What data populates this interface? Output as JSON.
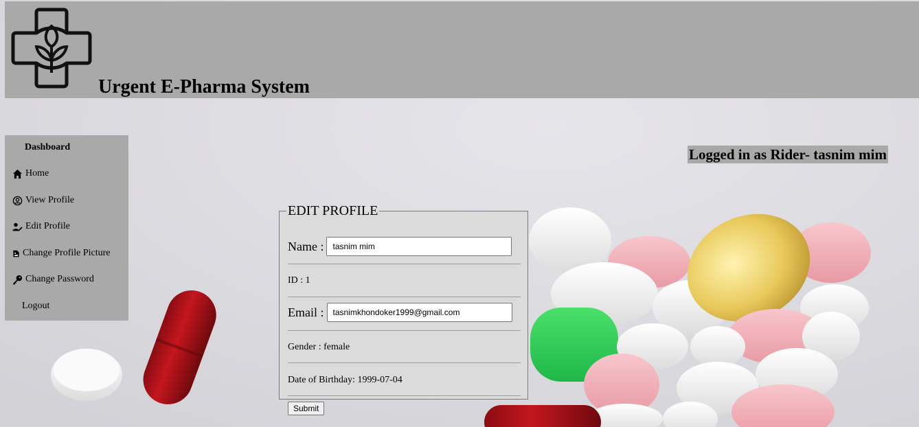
{
  "header": {
    "title": "Urgent E-Pharma System",
    "logo_icon": "pharmacy-cross-leaf-icon"
  },
  "sidebar": {
    "title": "Dashboard",
    "items": [
      {
        "label": "Home",
        "icon": "home-icon"
      },
      {
        "label": "View Profile",
        "icon": "user-circle-icon"
      },
      {
        "label": "Edit Profile",
        "icon": "user-edit-icon"
      },
      {
        "label": "Change Profile Picture",
        "icon": "file-image-icon"
      },
      {
        "label": "Change Password",
        "icon": "key-icon"
      },
      {
        "label": "Logout",
        "icon": ""
      }
    ]
  },
  "status": {
    "logged_in": "Logged in as Rider- tasnim mim"
  },
  "form": {
    "legend": "EDIT PROFILE",
    "name_label": "Name :",
    "name_value": "tasnim mim",
    "id_text": "ID : 1",
    "email_label": "Email :",
    "email_value": "tasnimkhondoker1999@gmail.com",
    "gender_text": "Gender : female",
    "dob_text": "Date of Birthday: 1999-07-04",
    "submit_label": "Submit"
  },
  "colors": {
    "header_bg": "#a9a9a9",
    "sidebar_bg": "#a9a9a9",
    "page_bg": "#dcdbe0"
  }
}
